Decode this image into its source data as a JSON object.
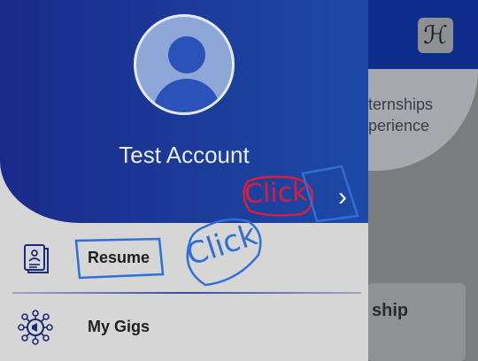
{
  "background": {
    "banner_line_1": "ternships",
    "banner_line_2": "perience",
    "card_title": "ship",
    "logo_icon": "app-logo-icon"
  },
  "drawer": {
    "account_name": "Test Account",
    "expand_icon": "chevron-right-icon",
    "menu": [
      {
        "label": "Resume",
        "icon": "resume-document-icon"
      },
      {
        "label": "My Gigs",
        "icon": "gigs-network-icon"
      }
    ]
  },
  "annotations": {
    "click_red": "Click",
    "click_blue": "Click"
  },
  "colors": {
    "drawer_header_start": "#1a2a8a",
    "drawer_header_end": "#1d4aa6",
    "annotation_red": "#d81e3a",
    "annotation_blue": "#2f6fd6"
  }
}
